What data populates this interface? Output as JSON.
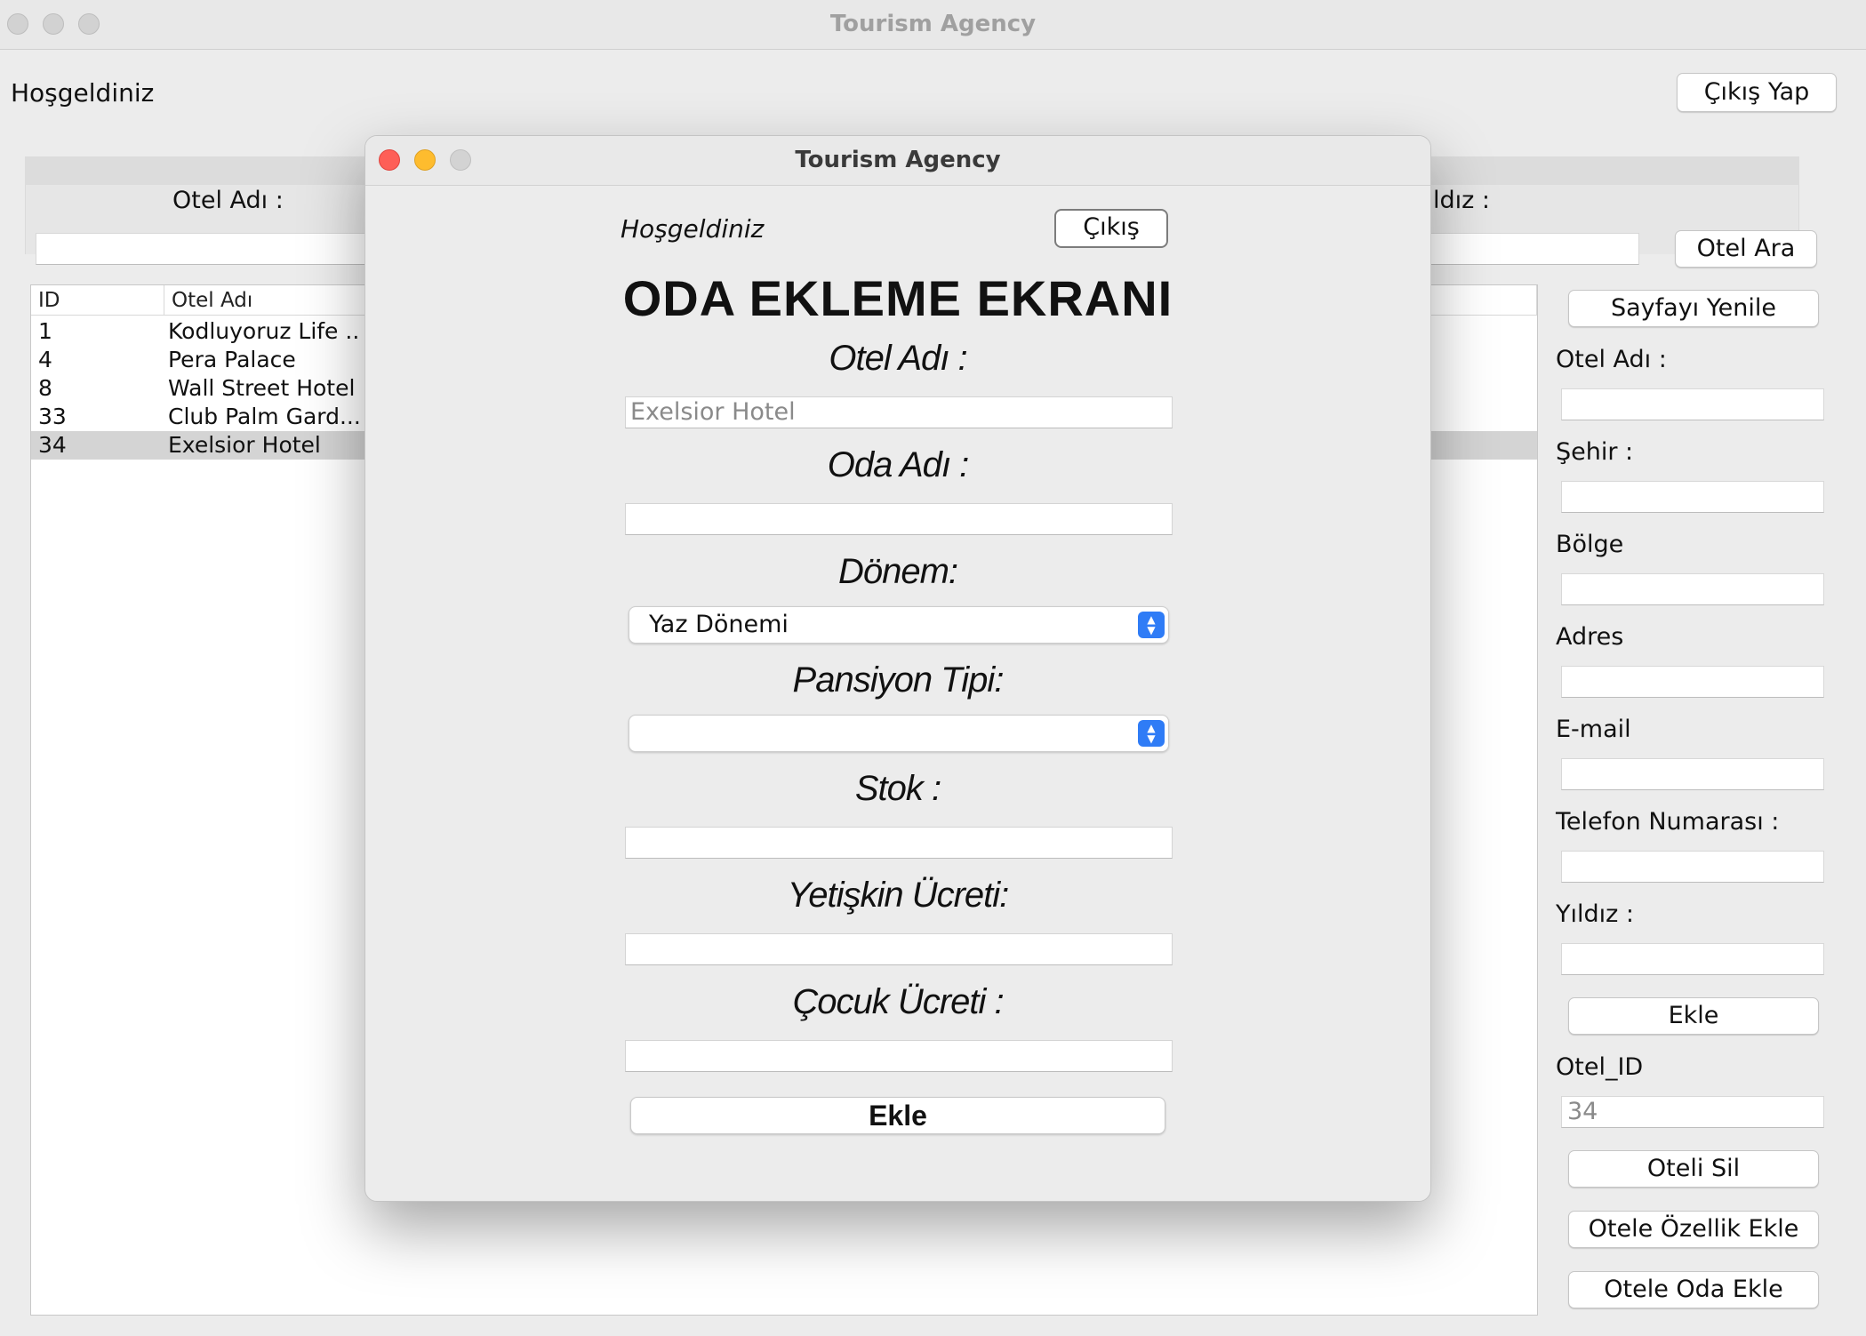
{
  "main": {
    "window_title": "Tourism Agency",
    "welcome": "Hoşgeldiniz",
    "logout_button": "Çıkış Yap",
    "search": {
      "hotel_name_label": "Otel Adı :",
      "star_label": "ldız :",
      "search_button": "Otel Ara"
    },
    "table": {
      "columns": [
        "ID",
        "Otel Adı"
      ],
      "rows": [
        {
          "id": "1",
          "name": "Kodluyoruz Life ..."
        },
        {
          "id": "4",
          "name": "Pera Palace"
        },
        {
          "id": "8",
          "name": "Wall Street Hotel"
        },
        {
          "id": "33",
          "name": "Club Palm Gard..."
        },
        {
          "id": "34",
          "name": "Exelsior Hotel"
        }
      ],
      "selected_row": 4
    },
    "form": {
      "refresh_button": "Sayfayı Yenile",
      "hotel_name_label": "Otel Adı :",
      "city_label": "Şehir :",
      "region_label": "Bölge",
      "address_label": "Adres",
      "email_label": "E-mail",
      "phone_label": "Telefon Numarası :",
      "star_label": "Yıldız :",
      "add_button": "Ekle",
      "hotel_id_label": "Otel_ID",
      "hotel_id_value": "34",
      "delete_button": "Oteli Sil",
      "add_feature_button": "Otele Özellik Ekle",
      "add_room_button": "Otele Oda Ekle"
    }
  },
  "dialog": {
    "window_title": "Tourism Agency",
    "welcome": "Hoşgeldiniz",
    "exit_button": "Çıkış",
    "heading": "ODA EKLEME EKRANI",
    "hotel_name_label": "Otel Adı :",
    "hotel_name_value": "Exelsior Hotel",
    "room_name_label": "Oda Adı :",
    "room_name_value": "",
    "period_label": "Dönem:",
    "period_selected": "Yaz Dönemi",
    "board_type_label": "Pansiyon Tipi:",
    "board_type_selected": "",
    "stock_label": "Stok :",
    "stock_value": "",
    "adult_price_label": "Yetişkin Ücreti:",
    "adult_price_value": "",
    "child_price_label": "Çocuk Ücreti :",
    "child_price_value": "",
    "submit_button": "Ekle"
  },
  "colors": {
    "window_bg": "#ececec",
    "close": "#fe5f57",
    "minimize": "#febc2e",
    "select_accent": "#2f7cf6",
    "selected_row": "#d4d4d4"
  }
}
